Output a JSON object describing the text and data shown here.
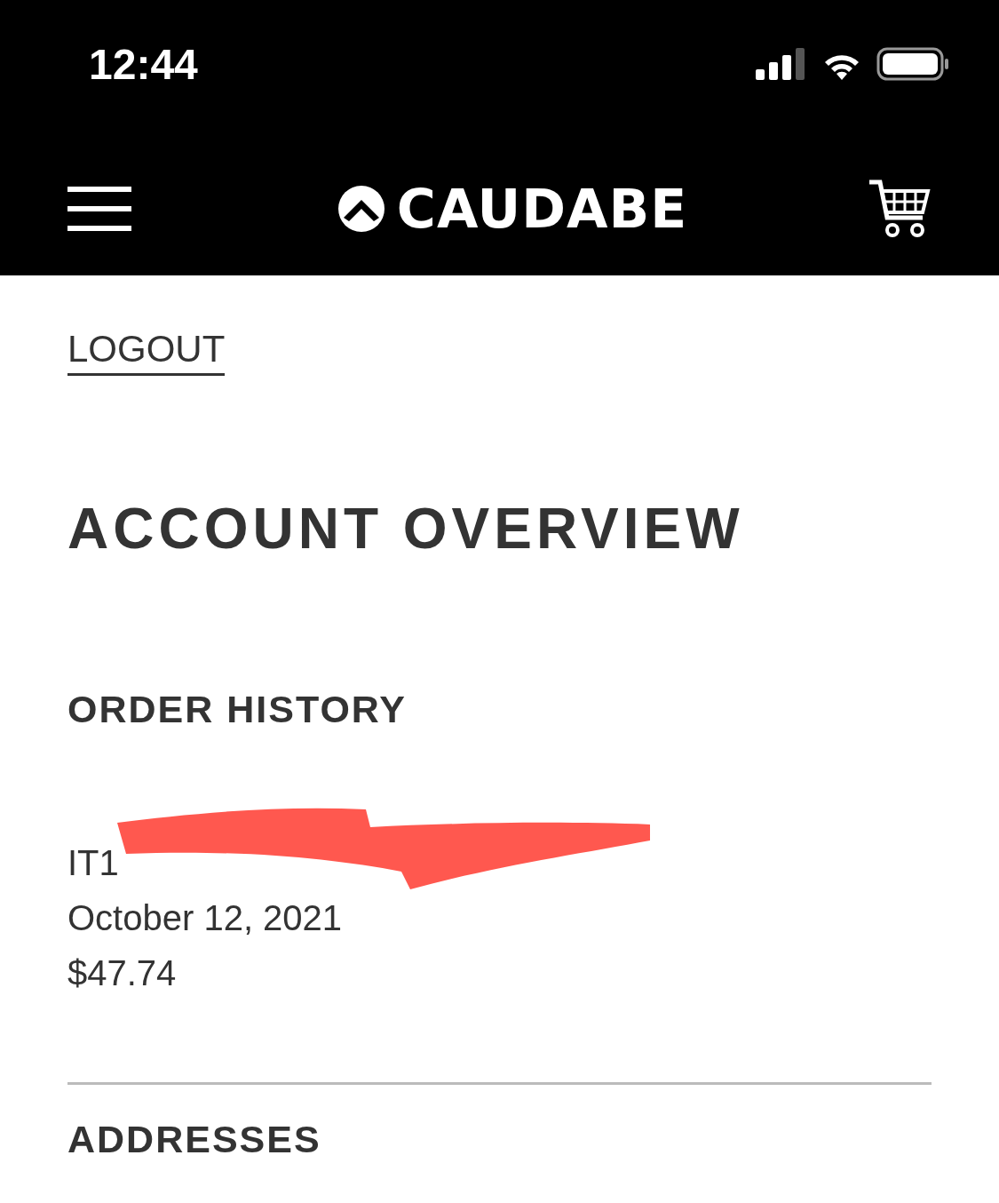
{
  "status_bar": {
    "time": "12:44"
  },
  "header": {
    "logo_text": "CAUDABE"
  },
  "logout": "LOGOUT",
  "title": "ACCOUNT OVERVIEW",
  "order_history": {
    "heading": "ORDER HISTORY",
    "orders": [
      {
        "number": "IT1",
        "redacted": true,
        "date": "October 12, 2021",
        "total": "$47.74"
      }
    ]
  },
  "addresses": {
    "heading": "ADDRESSES"
  }
}
